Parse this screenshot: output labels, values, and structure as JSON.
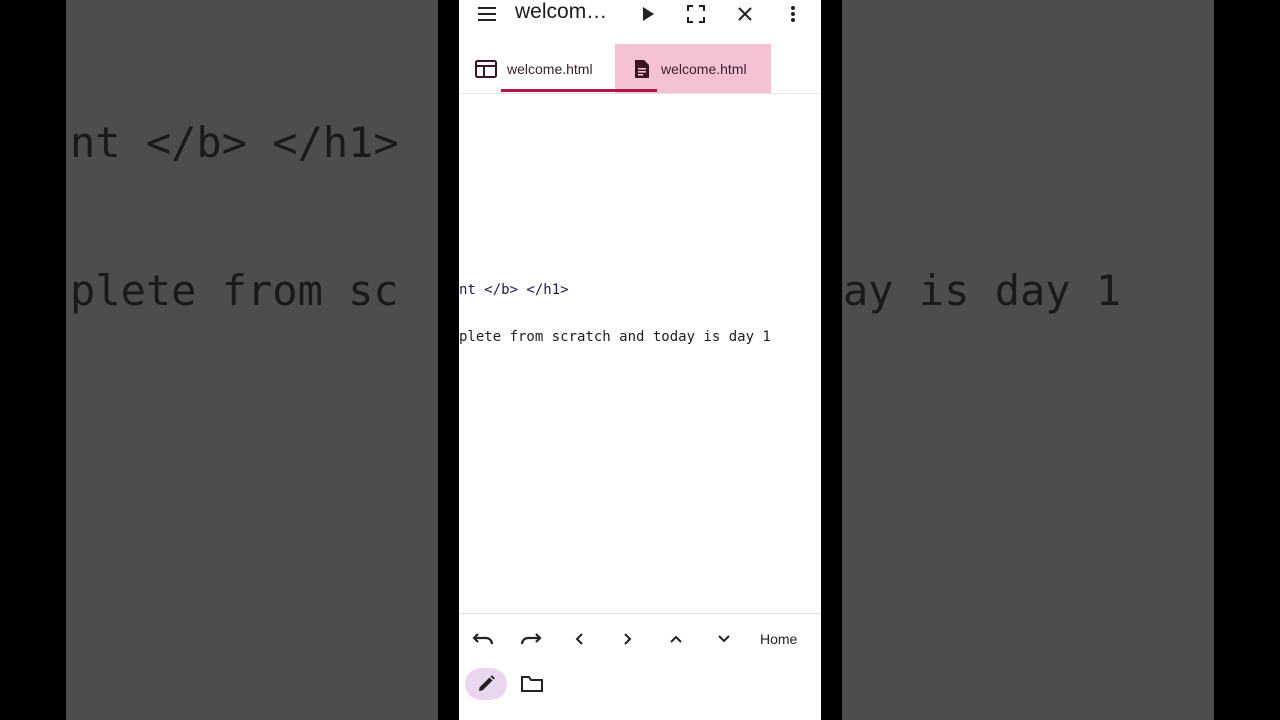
{
  "app": {
    "title": "welcom…"
  },
  "toolbar": {
    "menu_icon": "hamburger-menu-icon",
    "run_icon": "play-icon",
    "fullscreen_icon": "fullscreen-icon",
    "close_icon": "close-icon",
    "more_icon": "more-vert-icon"
  },
  "tabs": [
    {
      "label": "welcome.html",
      "icon": "browser-window-icon",
      "active": true
    },
    {
      "label": "welcome.html",
      "icon": "document-icon",
      "active": false
    }
  ],
  "editor": {
    "lines": [
      "nt </b> </h1>",
      "plete from scratch and today is day 1"
    ]
  },
  "background": {
    "line1": "nt </b> </h1>",
    "line2_left": "plete from sc",
    "line2_right": "ay is day 1"
  },
  "keys": {
    "undo_icon": "undo-icon",
    "redo_icon": "redo-icon",
    "left_icon": "chevron-left-icon",
    "right_icon": "chevron-right-icon",
    "up_icon": "chevron-up-icon",
    "down_icon": "chevron-down-icon",
    "home_label": "Home"
  },
  "colors": {
    "accent": "#b0164a",
    "tab_highlight": "#f5c2d3",
    "pill": "#ead7ef"
  }
}
